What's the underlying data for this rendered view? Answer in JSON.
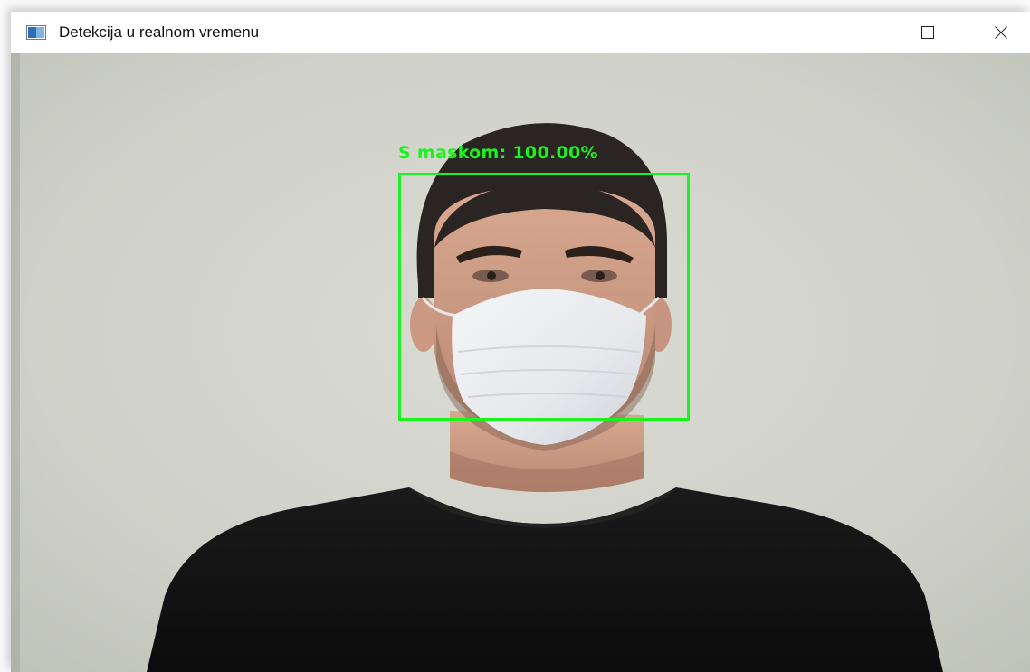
{
  "window": {
    "title": "Detekcija u realnom vremenu",
    "icon": "opencv-window-icon"
  },
  "caption_buttons": {
    "minimize_icon": "minimize-icon",
    "maximize_icon": "maximize-icon",
    "close_icon": "close-icon"
  },
  "detection": {
    "label": "S maskom: 100.00%",
    "color": "#1cf21c"
  }
}
